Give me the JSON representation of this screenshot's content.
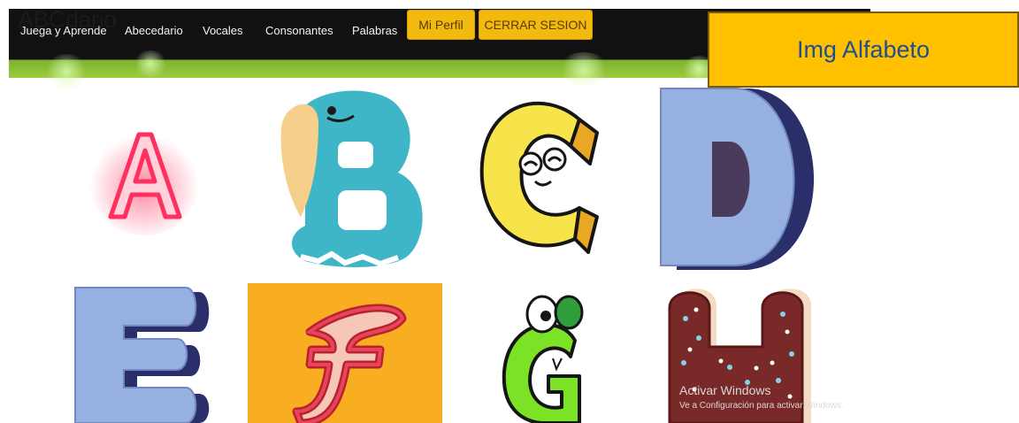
{
  "navbar": {
    "brand": "ABCdario",
    "links": [
      "Juega y Aprende",
      "Abecedario",
      "Vocales",
      "Consonantes",
      "Palabras"
    ],
    "profile_button": "Mi Perfil",
    "logout_button": "CERRAR SESION"
  },
  "callout": {
    "label": "Img Alfabeto"
  },
  "letters": [
    "A",
    "B",
    "C",
    "D",
    "E",
    "F",
    "G",
    "H"
  ],
  "watermark": {
    "title": "Activar Windows",
    "subtitle": "Ve a Configuración para activar Windows."
  },
  "colors": {
    "navbar": "#111111",
    "accent_button": "#f2b90f",
    "callout_fill": "#ffc000",
    "callout_text": "#1e4f91",
    "green_band": "#9ccc3e"
  }
}
